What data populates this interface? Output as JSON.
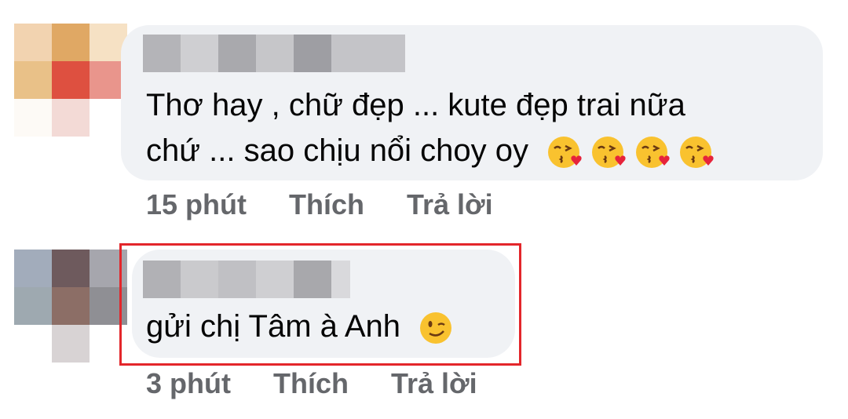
{
  "comments": [
    {
      "text_line1": "Thơ hay , chữ đẹp ... kute đẹp trai nữa",
      "text_line2": "chứ ... sao chịu nổi choy oy",
      "emoji": [
        "face-blowing-kiss",
        "face-blowing-kiss",
        "face-blowing-kiss",
        "face-blowing-kiss"
      ],
      "time": "15 phút",
      "like_label": "Thích",
      "reply_label": "Trả lời"
    },
    {
      "text": "gửi chị Tâm à Anh",
      "emoji": [
        "winking-face"
      ],
      "time": "3 phút",
      "like_label": "Thích",
      "reply_label": "Trả lời",
      "highlighted": true
    }
  ],
  "colors": {
    "bubble": "#f0f2f5",
    "meta_text": "#65676b",
    "highlight": "#e3262b"
  }
}
